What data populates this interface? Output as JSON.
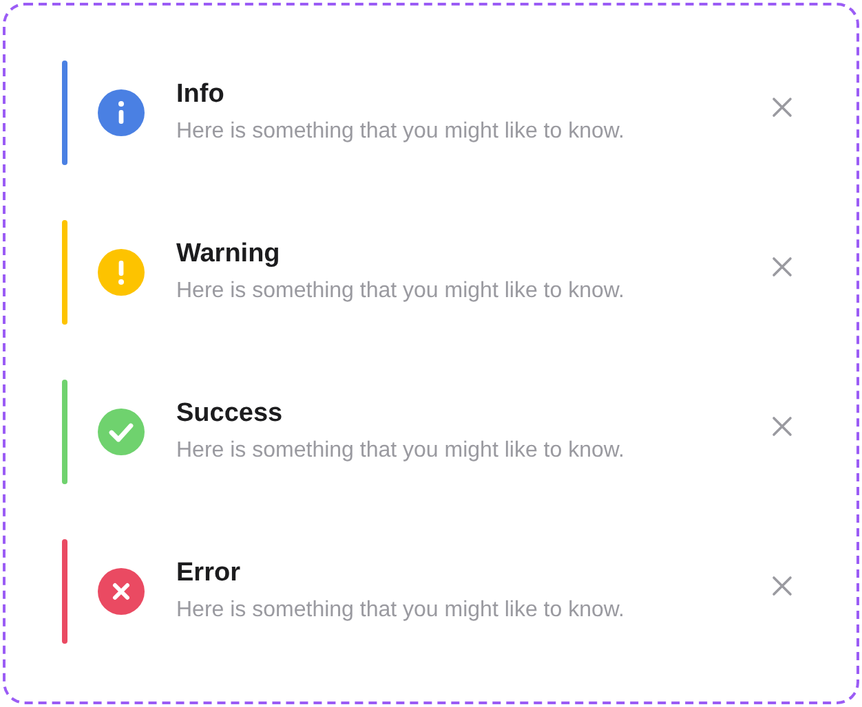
{
  "alerts": [
    {
      "kind": "info",
      "color": "#4a80e3",
      "title": "Info",
      "message": "Here is something that you might like to know."
    },
    {
      "kind": "warning",
      "color": "#fdc300",
      "title": "Warning",
      "message": "Here is something that you might like to know."
    },
    {
      "kind": "success",
      "color": "#6fd26e",
      "title": "Success",
      "message": "Here is something that you might like to know."
    },
    {
      "kind": "error",
      "color": "#ea4a62",
      "title": "Error",
      "message": "Here is something that you might like to know."
    }
  ]
}
